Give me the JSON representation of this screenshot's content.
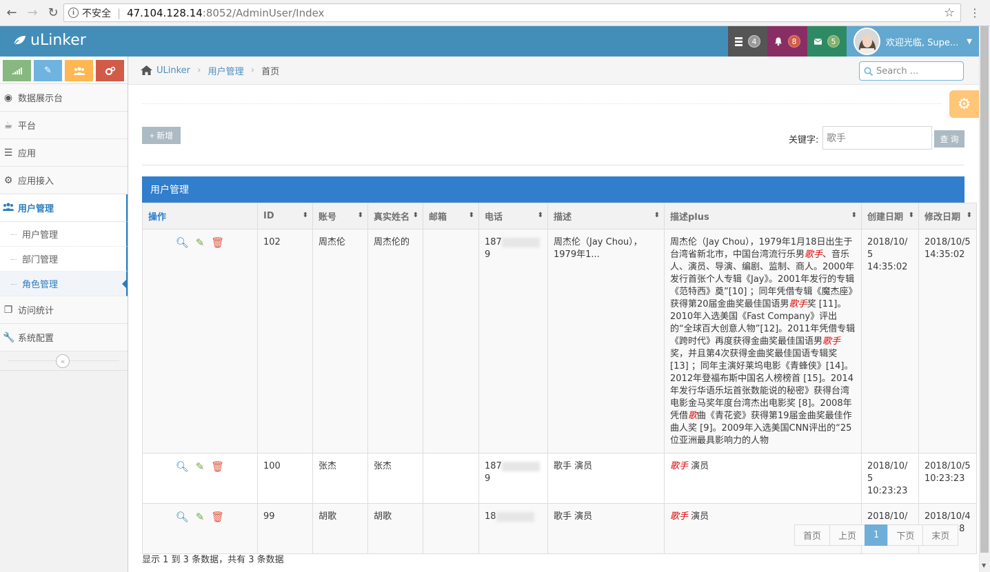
{
  "browser": {
    "insecure_label": "不安全",
    "url_host": "47.104.128.14",
    "url_rest": ":8052/AdminUser/Index"
  },
  "navbar": {
    "brand": "uLinker",
    "tasks_count": "4",
    "notifications_count": "8",
    "messages_count": "5",
    "user_greeting": "欢迎光临, Supe..."
  },
  "sidebar": {
    "items": [
      {
        "label": "数据展示台",
        "icon": "dashboard-icon"
      },
      {
        "label": "平台",
        "icon": "coffee-icon"
      },
      {
        "label": "应用",
        "icon": "list-icon"
      },
      {
        "label": "应用接入",
        "icon": "cog-icon"
      },
      {
        "label": "用户管理",
        "icon": "users-icon"
      },
      {
        "label": "访问统计",
        "icon": "copy-icon"
      },
      {
        "label": "系统配置",
        "icon": "wrench-icon"
      }
    ],
    "submenu": [
      "用户管理",
      "部门管理",
      "角色管理"
    ]
  },
  "breadcrumb": {
    "home": "ULinker",
    "section": "用户管理",
    "current": "首页"
  },
  "search": {
    "placeholder": "Search ..."
  },
  "toolbar": {
    "add_label": "+ 新增",
    "keyword_label": "关键字:",
    "keyword_value": "歌手",
    "query_label": "查 询"
  },
  "table": {
    "title": "用户管理",
    "columns": [
      "操作",
      "ID",
      "账号",
      "真实姓名",
      "邮箱",
      "电话",
      "描述",
      "描述plus",
      "创建日期",
      "修改日期"
    ],
    "rows": [
      {
        "id": "102",
        "account": "周杰伦",
        "realname": "周杰伦的",
        "email": "",
        "phone_start": "187",
        "phone_end": "9",
        "desc": "周杰伦（Jay Chou），1979年1...",
        "descplus_a": "周杰伦（Jay Chou），1979年1月18日出生于台湾省新北市，中国台湾流行乐男",
        "descplus_hl1": "歌手",
        "descplus_b": "、音乐人、演员、导演、编剧、监制、商人。2000年发行首张个人专辑《Jay》。2001年发行的专辑《范特西》奠”[10] ；同年凭借专辑《魔杰座》获得第20届金曲奖最佳国语男",
        "descplus_hl2": "歌手",
        "descplus_c": "奖 [11]。2010年入选美国《Fast Company》评出的“全球百大创意人物”[12]。2011年凭借专辑《跨时代》再度获得金曲奖最佳国语男",
        "descplus_hl3": "歌手",
        "descplus_d": "奖，并且第4次获得金曲奖最佳国语专辑奖 [13] ；同年主演好莱坞电影《青蜂侠》[14]。2012年登福布斯中国名人榜榜首 [15]。2014年发行华语乐坛首张数能说的秘密》获得台湾电影金马奖年度台湾杰出电影奖 [8]。2008年凭借",
        "descplus_hl4": "歌",
        "descplus_e": "曲《青花瓷》获得第19届金曲奖最佳作曲人奖 [9]。2009年入选美国CNN评出的“25位亚洲最具影响力的人物",
        "created": "2018/10/5 14:35:02",
        "modified": "2018/10/5 14:35:02"
      },
      {
        "id": "100",
        "account": "张杰",
        "realname": "张杰",
        "email": "",
        "phone_start": "187",
        "phone_end": "9",
        "desc": "歌手 演员",
        "descplus_hl": "歌手",
        "descplus_rest": " 演员",
        "created": "2018/10/5 10:23:23",
        "modified": "2018/10/5 10:23:23"
      },
      {
        "id": "99",
        "account": "胡歌",
        "realname": "胡歌",
        "email": "",
        "phone_start": "18",
        "phone_end": "",
        "desc": "歌手 演员",
        "descplus_hl": "歌手",
        "descplus_rest": " 演员",
        "created": "2018/10/4 17:08:38",
        "modified": "2018/10/4 17:08:38"
      }
    ]
  },
  "pager": {
    "first": "首页",
    "prev": "上页",
    "page": "1",
    "next": "下页",
    "last": "末页"
  },
  "summary": "显示 1 到 3 条数据，共有 3 条数据",
  "colors": {
    "navbar": "#438eb9",
    "accent": "#307ecc",
    "highlight": "#dd0000"
  }
}
